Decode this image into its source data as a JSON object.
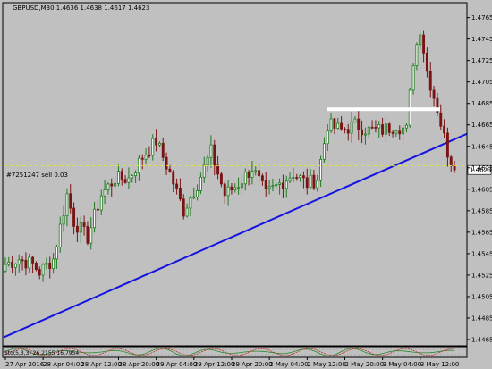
{
  "header": {
    "title": "GBPUSD,M30 1.4636 1.4638 1.4617 1.4623"
  },
  "order_line": {
    "label": "#7251247 sell 0.03",
    "price": 1.4627,
    "color": "#e0e040"
  },
  "price_badge": {
    "label": "1.4623",
    "value": 1.4623
  },
  "indicator": {
    "label": "Sto(5,3,3) 26.2155 16.7954",
    "levels": [
      20,
      80
    ],
    "color_main": "#2a8a2a",
    "color_signal": "#c03030"
  },
  "colors": {
    "background": "#c0c0c0",
    "bull": "#1e7a1e",
    "bear": "#7a1414",
    "trendline": "#1414e0",
    "resistance": "#ffffff"
  },
  "chart_data": {
    "type": "candlestick",
    "title": "GBPUSD,M30 1.4636 1.4638 1.4617 1.4623",
    "ylim": [
      1.446,
      1.4778
    ],
    "yticks": [
      "1.4765",
      "1.4745",
      "1.4725",
      "1.4705",
      "1.4685",
      "1.4665",
      "1.4645",
      "1.4625",
      "1.4605",
      "1.4585",
      "1.4565",
      "1.4545",
      "1.4525",
      "1.4505",
      "1.4485",
      "1.4465"
    ],
    "xticks": [
      "27 Apr 2016",
      "28 Apr 04:00",
      "28 Apr 12:00",
      "28 Apr 20:00",
      "29 Apr 04:00",
      "29 Apr 12:00",
      "29 Apr 20:00",
      "2 May 04:00",
      "2 May 12:00",
      "2 May 20:00",
      "3 May 04:00",
      "3 May 12:00"
    ],
    "anchors": [
      [
        0,
        1.4535
      ],
      [
        4,
        1.454
      ],
      [
        8,
        1.4535
      ],
      [
        10,
        1.4528
      ],
      [
        14,
        1.454
      ],
      [
        18,
        1.46
      ],
      [
        20,
        1.4575
      ],
      [
        24,
        1.456
      ],
      [
        28,
        1.46
      ],
      [
        32,
        1.4615
      ],
      [
        36,
        1.4615
      ],
      [
        40,
        1.4635
      ],
      [
        44,
        1.465
      ],
      [
        48,
        1.462
      ],
      [
        52,
        1.4585
      ],
      [
        56,
        1.461
      ],
      [
        60,
        1.464
      ],
      [
        64,
        1.46
      ],
      [
        68,
        1.461
      ],
      [
        72,
        1.4625
      ],
      [
        76,
        1.46
      ],
      [
        80,
        1.461
      ],
      [
        84,
        1.462
      ],
      [
        88,
        1.461
      ],
      [
        91,
        1.4615
      ],
      [
        94,
        1.4665
      ],
      [
        98,
        1.466
      ],
      [
        102,
        1.4665
      ],
      [
        106,
        1.466
      ],
      [
        110,
        1.466
      ],
      [
        114,
        1.4665
      ],
      [
        117,
        1.466
      ],
      [
        119,
        1.4725
      ],
      [
        121,
        1.4755
      ],
      [
        123,
        1.4715
      ],
      [
        126,
        1.468
      ],
      [
        129,
        1.464
      ],
      [
        131,
        1.4623
      ]
    ],
    "trendline": [
      [
        0,
        1.4467
      ],
      [
        131,
        1.465
      ]
    ],
    "resistance": [
      [
        94,
        1.468
      ],
      [
        126,
        1.468
      ]
    ]
  }
}
